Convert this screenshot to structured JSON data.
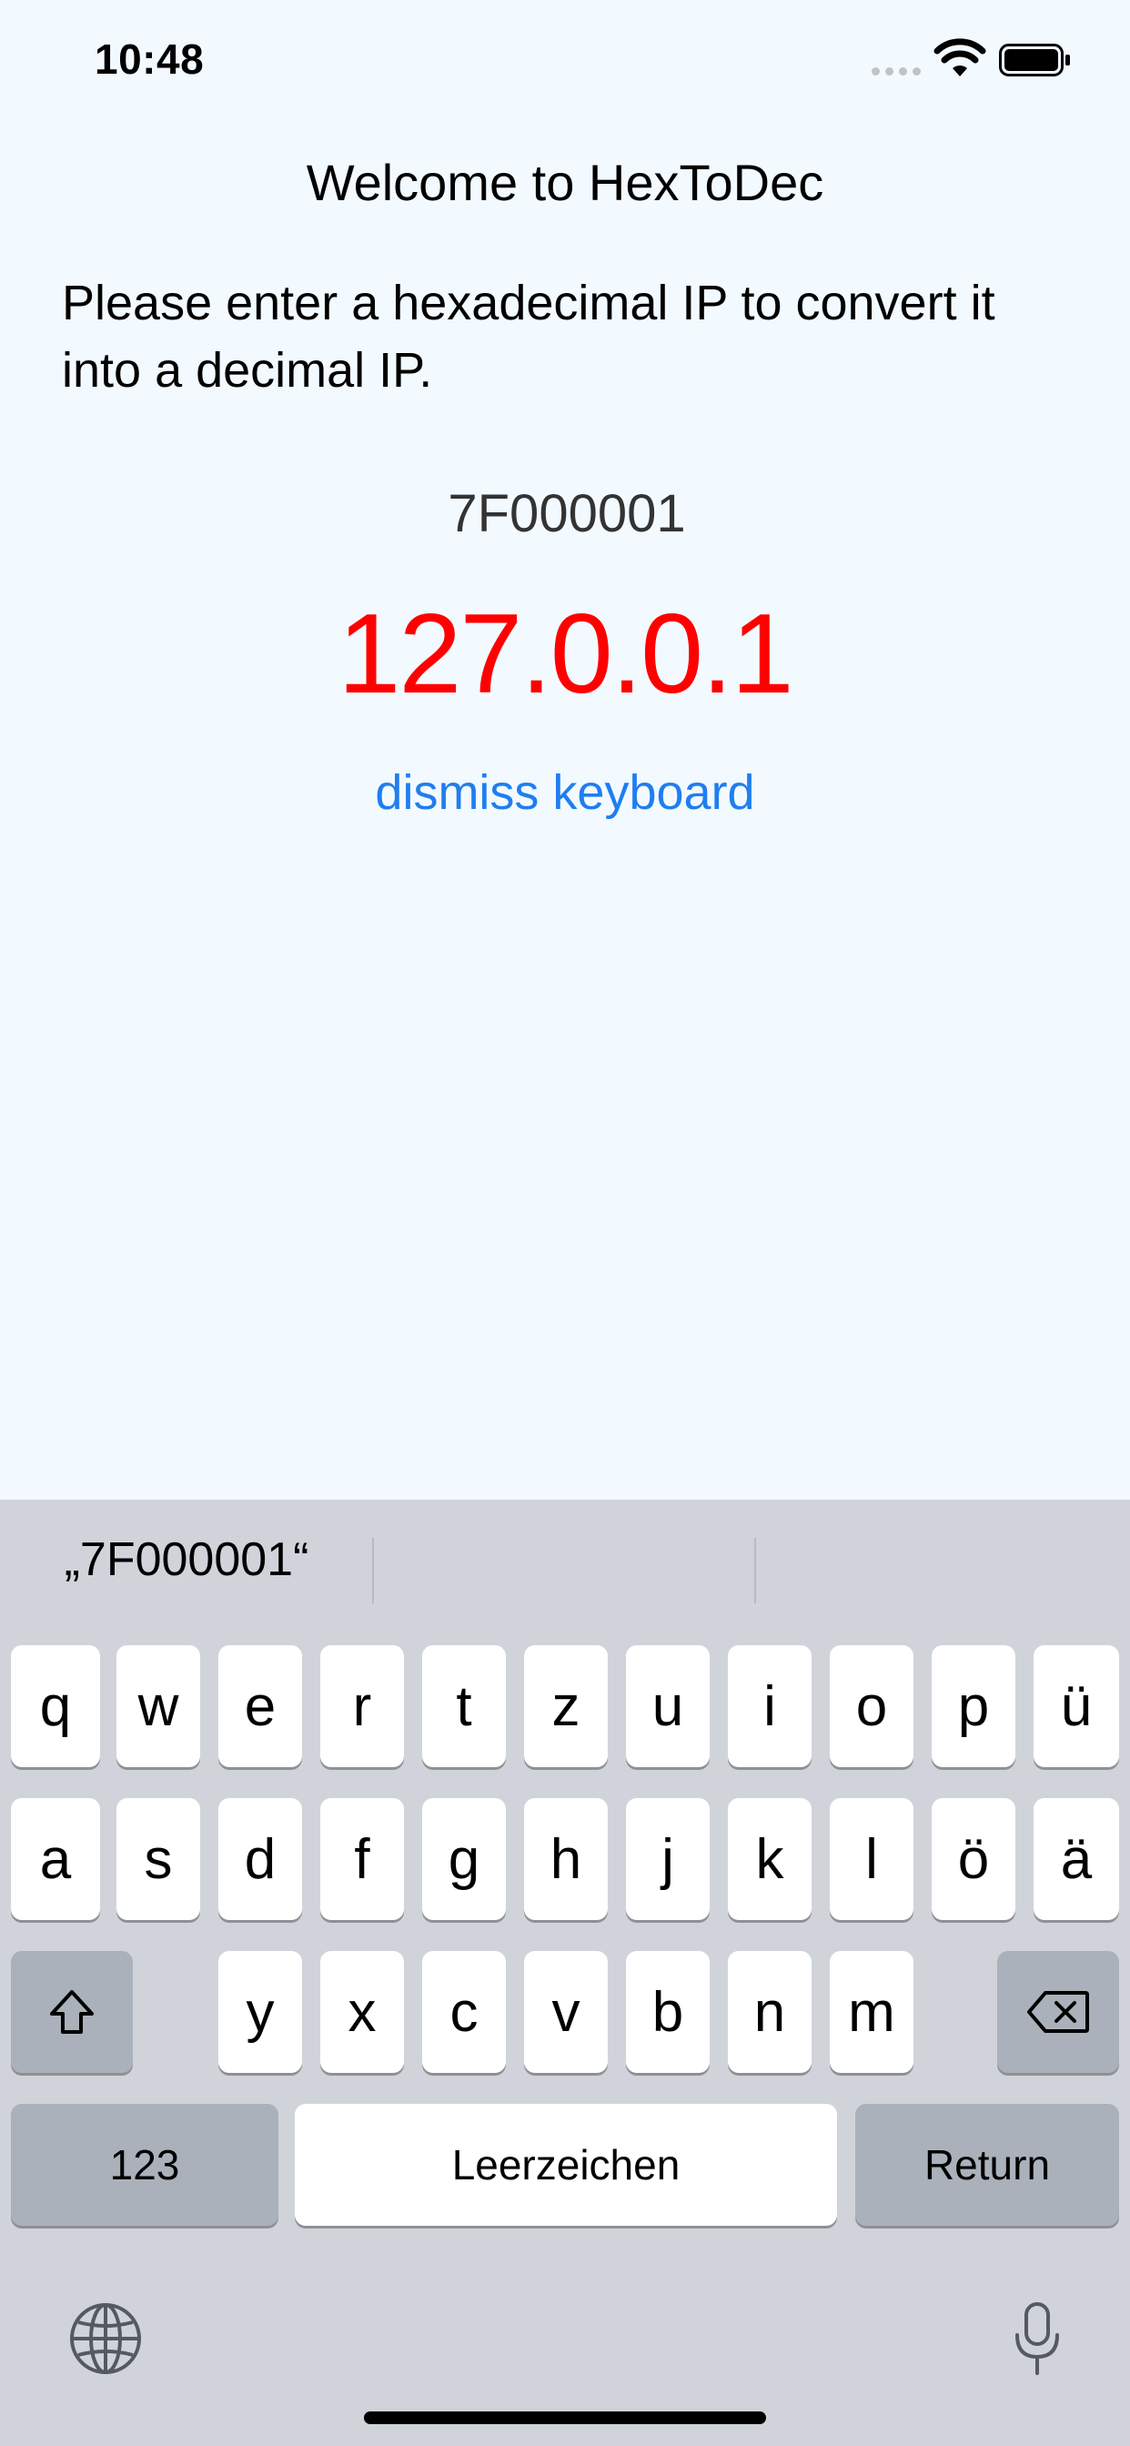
{
  "status_bar": {
    "time": "10:48"
  },
  "app": {
    "title": "Welcome to HexToDec",
    "instructions": "Please enter a hexadecimal IP to convert it into a decimal IP.",
    "hex_input_value": "7F000001",
    "decimal_result": "127.0.0.1",
    "dismiss_label": "dismiss keyboard",
    "colors": {
      "background": "#f3faff",
      "result": "#ff0000",
      "link": "#1f7ef0"
    }
  },
  "keyboard": {
    "suggestions": [
      "„7F000001“",
      "",
      ""
    ],
    "row1": [
      "q",
      "w",
      "e",
      "r",
      "t",
      "z",
      "u",
      "i",
      "o",
      "p",
      "ü"
    ],
    "row2": [
      "a",
      "s",
      "d",
      "f",
      "g",
      "h",
      "j",
      "k",
      "l",
      "ö",
      "ä"
    ],
    "row3": [
      "y",
      "x",
      "c",
      "v",
      "b",
      "n",
      "m"
    ],
    "shift_icon": "shift-icon",
    "delete_icon": "backspace-icon",
    "numbers_label": "123",
    "space_label": "Leerzeichen",
    "return_label": "Return",
    "globe_icon": "globe-icon",
    "mic_icon": "microphone-icon"
  }
}
